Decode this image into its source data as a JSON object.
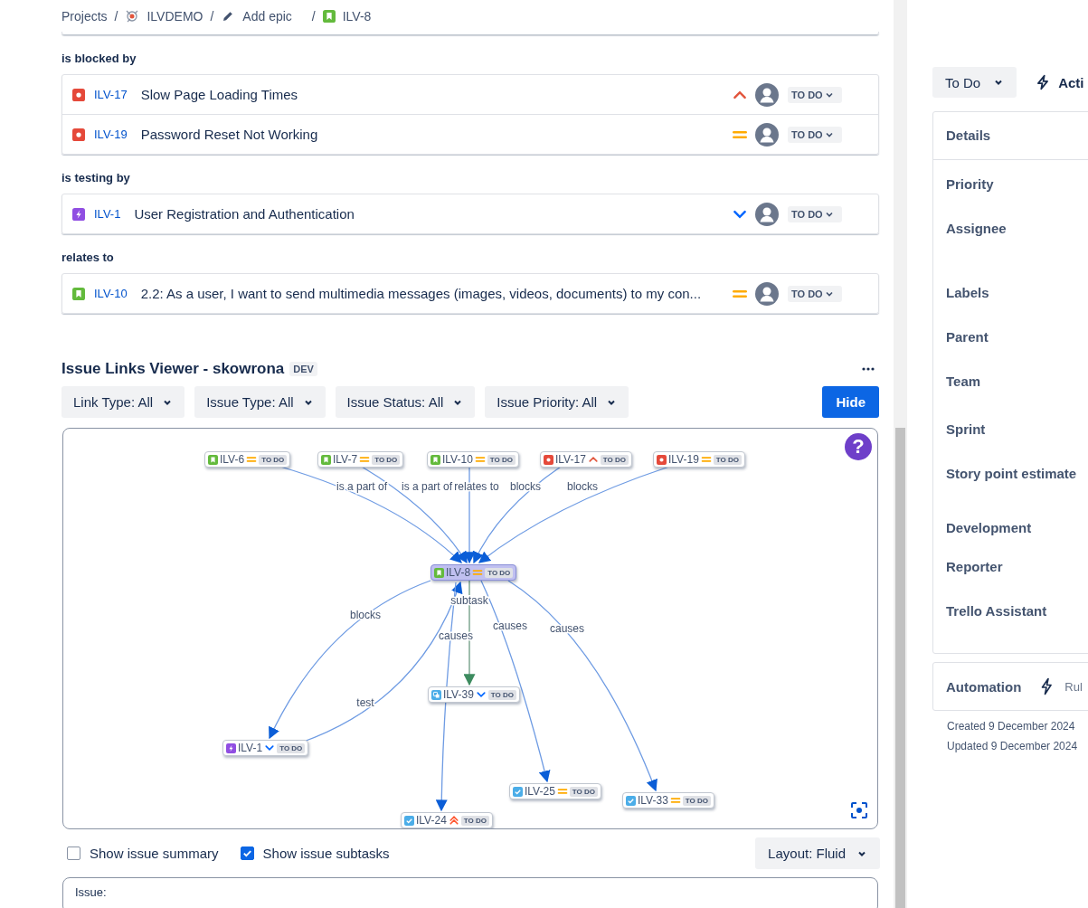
{
  "breadcrumbs": [
    {
      "kind": "text",
      "label": "Projects"
    },
    {
      "kind": "project",
      "prefix": "/",
      "label": "ILVDEMO"
    },
    {
      "kind": "edit",
      "prefix": "/",
      "label": "Add epic"
    },
    {
      "kind": "story",
      "prefix": "/",
      "label": "ILV-8"
    }
  ],
  "link_groups": [
    {
      "label": "is blocked by",
      "issues": [
        {
          "kind": "bug",
          "key": "ILV-17",
          "summary": "Slow Page Loading Times",
          "priority": {
            "kind": "high"
          },
          "status": "TO DO"
        },
        {
          "kind": "bug",
          "key": "ILV-19",
          "summary": "Password Reset Not Working",
          "priority": {
            "kind": "medium"
          },
          "status": "TO DO"
        }
      ]
    },
    {
      "label": "is testing by",
      "issues": [
        {
          "kind": "epic",
          "key": "ILV-1",
          "summary": "User Registration and Authentication",
          "priority": {
            "kind": "low"
          },
          "status": "TO DO"
        }
      ]
    },
    {
      "label": "relates to",
      "issues": [
        {
          "kind": "story",
          "key": "ILV-10",
          "summary": "2.2: As a user, I want to send multimedia messages (images, videos, documents) to my con...",
          "priority": {
            "kind": "medium"
          },
          "status": "TO DO"
        }
      ]
    }
  ],
  "viewer": {
    "title": "Issue Links Viewer - skowrona",
    "badge": "DEV",
    "filters": [
      "Link Type: All",
      "Issue Type: All",
      "Issue Status: All",
      "Issue Priority: All"
    ],
    "hide_button": "Hide",
    "help": "?",
    "graph": {
      "nodes": [
        {
          "kind": "story",
          "key": "ILV-6",
          "priority": {
            "kind": "medium"
          },
          "status": "TO DO",
          "selected": false
        },
        {
          "kind": "story",
          "key": "ILV-7",
          "priority": {
            "kind": "medium"
          },
          "status": "TO DO",
          "selected": false
        },
        {
          "kind": "story",
          "key": "ILV-10",
          "priority": {
            "kind": "medium"
          },
          "status": "TO DO",
          "selected": false
        },
        {
          "kind": "bug",
          "key": "ILV-17",
          "priority": {
            "kind": "high"
          },
          "status": "TO DO",
          "selected": false
        },
        {
          "kind": "bug",
          "key": "ILV-19",
          "priority": {
            "kind": "medium"
          },
          "status": "TO DO",
          "selected": false
        },
        {
          "kind": "story",
          "key": "ILV-8",
          "priority": {
            "kind": "medium"
          },
          "status": "TO DO",
          "selected": true
        },
        {
          "kind": "subtask",
          "key": "ILV-39",
          "priority": {
            "kind": "low"
          },
          "status": "TO DO",
          "selected": false
        },
        {
          "kind": "epic",
          "key": "ILV-1",
          "priority": {
            "kind": "low"
          },
          "status": "TO DO",
          "selected": false
        },
        {
          "kind": "task",
          "key": "ILV-25",
          "priority": {
            "kind": "medium"
          },
          "status": "TO DO",
          "selected": false
        },
        {
          "kind": "task",
          "key": "ILV-33",
          "priority": {
            "kind": "medium"
          },
          "status": "TO DO",
          "selected": false
        },
        {
          "kind": "task",
          "key": "ILV-24",
          "priority": {
            "kind": "highest"
          },
          "status": "TO DO",
          "selected": false
        }
      ],
      "edges": [
        {
          "kind": "link",
          "label": "is a part of"
        },
        {
          "kind": "link",
          "label": "is a part of"
        },
        {
          "kind": "link",
          "label": "relates to"
        },
        {
          "kind": "link",
          "label": "blocks"
        },
        {
          "kind": "link",
          "label": "blocks"
        },
        {
          "kind": "link",
          "label": "blocks"
        },
        {
          "kind": "link",
          "label": "test"
        },
        {
          "kind": "subtask",
          "label": "subtask"
        },
        {
          "kind": "link",
          "label": "causes"
        },
        {
          "kind": "link",
          "label": "causes"
        },
        {
          "kind": "link",
          "label": "causes"
        }
      ]
    },
    "options": [
      {
        "label": "Show issue summary",
        "checked": false
      },
      {
        "label": "Show issue subtasks",
        "checked": true
      }
    ],
    "layout_button": "Layout: Fluid",
    "issue_panel": {
      "label": "Issue:"
    }
  },
  "sidebar": {
    "status_button": "To Do",
    "action_button": "Acti",
    "details": {
      "title": "Details",
      "fields": [
        "Priority",
        "Assignee",
        "Labels",
        "Parent",
        "Team",
        "Sprint",
        "Story point estimate",
        "Development",
        "Reporter",
        "Trello Assistant"
      ]
    },
    "automation": {
      "title": "Automation",
      "rules": "Rul"
    },
    "created": "Created 9 December 2024",
    "updated": "Updated 9 December 2024"
  }
}
